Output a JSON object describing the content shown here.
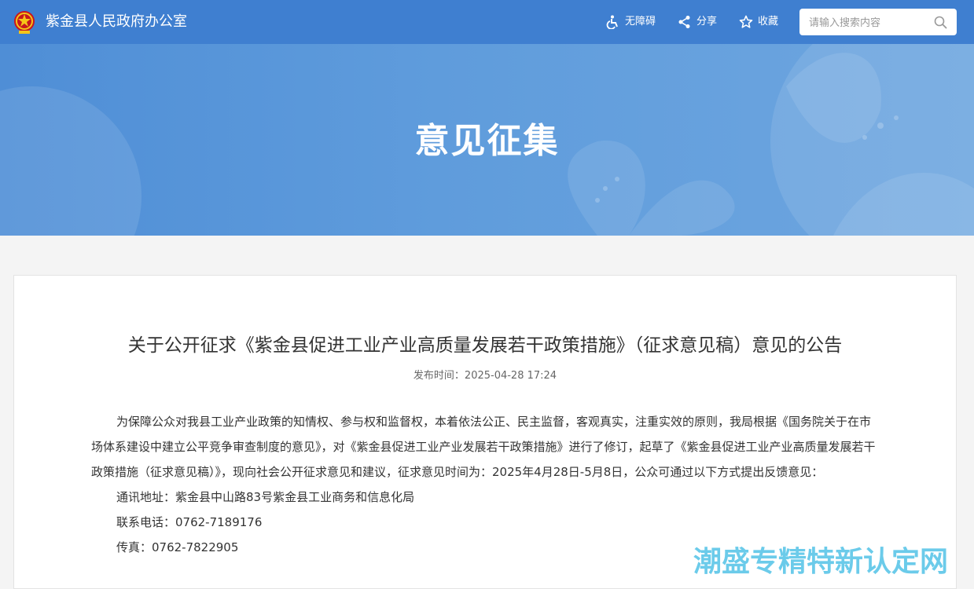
{
  "header": {
    "site_name": "紫金县人民政府办公室",
    "tools": [
      {
        "label": "无障碍",
        "icon": "accessibility-icon"
      },
      {
        "label": "分享",
        "icon": "share-icon"
      },
      {
        "label": "收藏",
        "icon": "star-icon"
      }
    ],
    "search": {
      "placeholder": "请输入搜索内容",
      "value": ""
    }
  },
  "banner": {
    "title": "意见征集"
  },
  "article": {
    "title": "关于公开征求《紫金县促进工业产业高质量发展若干政策措施》（征求意见稿）意见的公告",
    "publish_label": "发布时间：",
    "publish_time": "2025-04-28 17:24",
    "paragraph": "为保障公众对我县工业产业政策的知情权、参与权和监督权，本着依法公正、民主监督，客观真实，注重实效的原则，我局根据《国务院关于在市场体系建设中建立公平竞争审查制度的意见》，对《紫金县促进工业产业发展若干政策措施》进行了修订，起草了《紫金县促进工业产业高质量发展若干政策措施（征求意见稿）》，现向社会公开征求意见和建议，征求意见时间为：2025年4月28日-5月8日，公众可通过以下方式提出反馈意见：",
    "address": "通讯地址：紫金县中山路83号紫金县工业商务和信息化局",
    "phone": "联系电话：0762-7189176",
    "fax": "传真：0762-7822905"
  },
  "watermark": "潮盛专精特新认定网",
  "colors": {
    "banner": "#5f9cdc",
    "topbar": "#3f7fd0",
    "watermark": "#5cc6e8"
  }
}
